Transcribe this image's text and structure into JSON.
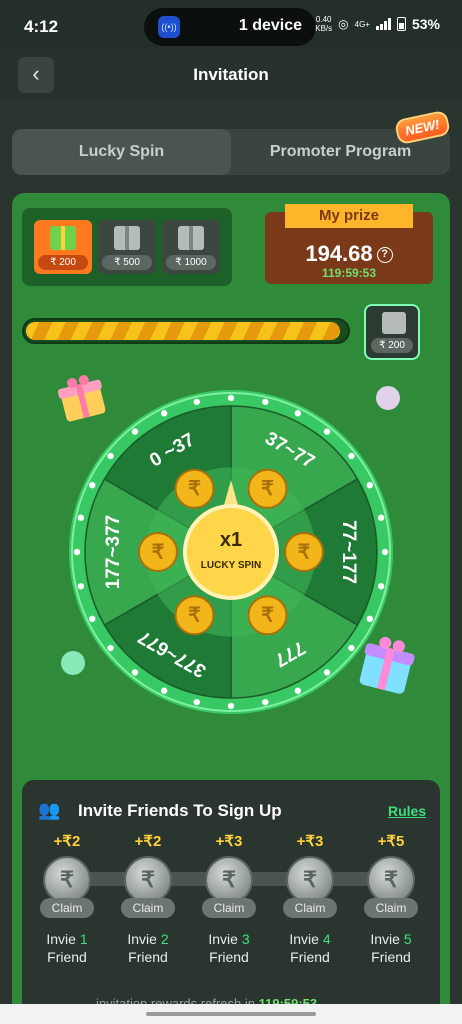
{
  "status": {
    "time": "4:12",
    "device_label": "1 device",
    "net_speed": "0.40",
    "net_unit": "KB/s",
    "net_type": "4G+",
    "battery": "53%"
  },
  "header": {
    "title": "Invitation",
    "back_icon": "chevron-left-icon"
  },
  "tabs": [
    {
      "label": "Lucky Spin",
      "active": true
    },
    {
      "label": "Promoter Program",
      "active": false
    }
  ],
  "new_badge": "NEW!",
  "prize_tiers": [
    {
      "amount": "₹ 200",
      "active": true
    },
    {
      "amount": "₹ 500",
      "active": false
    },
    {
      "amount": "₹ 1000",
      "active": false
    }
  ],
  "my_prize": {
    "label": "My prize",
    "value": "194.68",
    "timer": "119:59:53"
  },
  "progress": {
    "fraction": 0.97,
    "target_amount": "₹ 200"
  },
  "wheel": {
    "segments": [
      "37~77",
      "77~177",
      "777",
      "377~677",
      "177~377",
      "0 ~37"
    ],
    "center_multiplier": "x1",
    "center_label": "LUCKY SPIN"
  },
  "invite": {
    "title": "Invite Friends To Sign Up",
    "rules_label": "Rules",
    "steps": [
      {
        "reward": "+₹2",
        "claim": "Claim",
        "text": "Invie",
        "num": "1",
        "suffix": "Friend"
      },
      {
        "reward": "+₹2",
        "claim": "Claim",
        "text": "Invie",
        "num": "2",
        "suffix": "Friend"
      },
      {
        "reward": "+₹3",
        "claim": "Claim",
        "text": "Invie",
        "num": "3",
        "suffix": "Friend"
      },
      {
        "reward": "+₹3",
        "claim": "Claim",
        "text": "Invie",
        "num": "4",
        "suffix": "Friend"
      },
      {
        "reward": "+₹5",
        "claim": "Claim",
        "text": "Invie",
        "num": "5",
        "suffix": "Friend"
      }
    ],
    "footer_text": "invitation rewards refresh in",
    "footer_timer": "119:59:53"
  },
  "colors": {
    "accent_green": "#3fe07a",
    "panel_green": "#2f8a3a",
    "gold": "#ffd23a"
  }
}
